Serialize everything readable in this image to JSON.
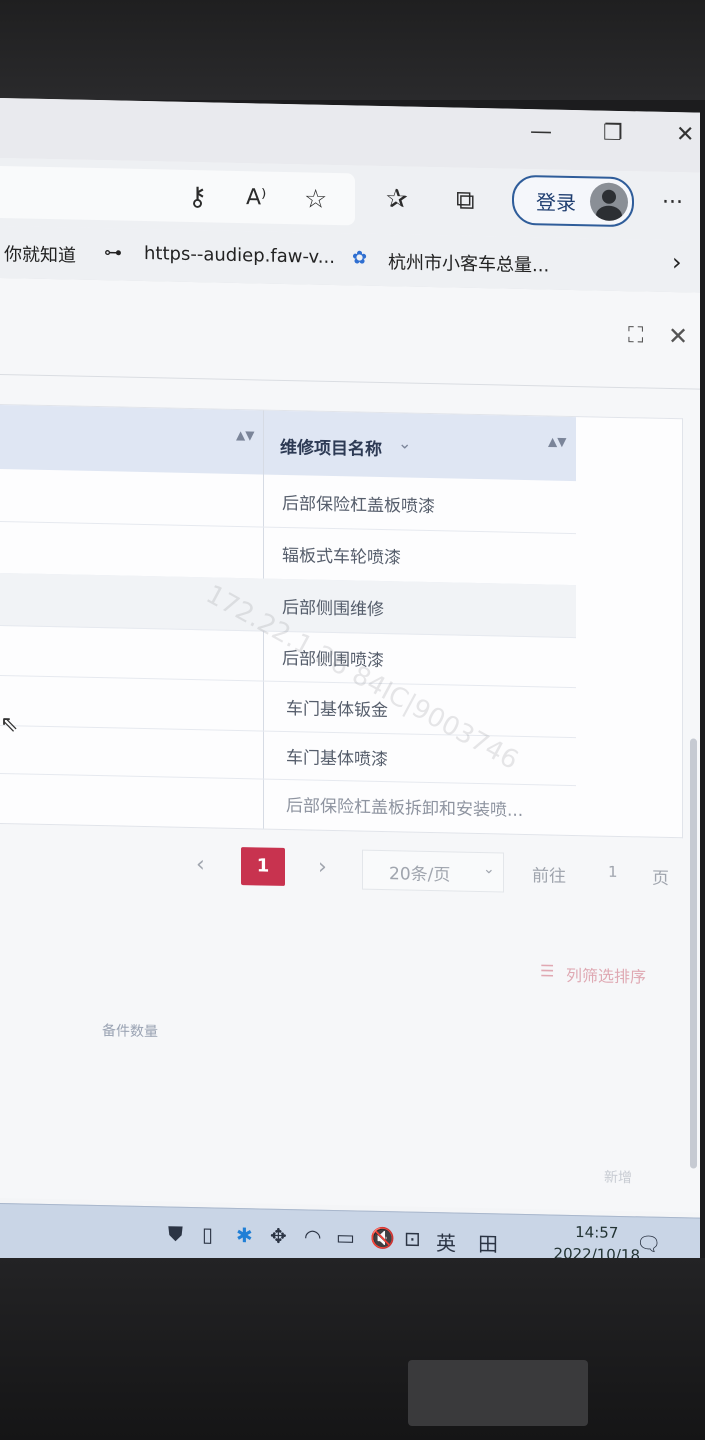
{
  "window": {
    "minimize_icon": "minimize-icon",
    "restore_icon": "restore-icon",
    "close_icon": "close-icon",
    "minimize_glyph": "—",
    "restore_glyph": "❐",
    "close_glyph": "✕"
  },
  "toolbar": {
    "key_glyph": "⚷",
    "read_aloud": "A⁾",
    "favorite_glyph": "☆",
    "favorites_glyph": "✰",
    "collections_glyph": "⧉",
    "login_label": "登录",
    "more_glyph": "···"
  },
  "bookmarks": {
    "items": [
      {
        "label": "你就知道"
      },
      {
        "label": "https--audiep.faw-v..."
      },
      {
        "label": "杭州市小客车总量..."
      }
    ],
    "link_glyph": "⊶",
    "flower_glyph": "✿",
    "more_glyph": "›"
  },
  "dialog": {
    "fullscreen_glyph": "⛶",
    "close_glyph": "✕"
  },
  "table": {
    "column_header": "维修项目名称",
    "header_chevron": "⌄",
    "sort_glyph": "▲▼",
    "rows": [
      "后部保险杠盖板喷漆",
      "辐板式车轮喷漆",
      "后部侧围维修",
      "后部侧围喷漆",
      "车门基体钣金",
      "车门基体喷漆",
      "后部保险杠盖板拆卸和安装喷..."
    ]
  },
  "pagination": {
    "prev": "‹",
    "current_page": "1",
    "next": "›",
    "page_size": "20条/页",
    "goto_label": "前往",
    "goto_value": "1",
    "page_suffix": "页"
  },
  "footer": {
    "column_filter_sort": "列筛选排序",
    "filter_glyph": "☰",
    "spare_parts": "备件数量",
    "bottom_right": "新增"
  },
  "watermark": "172.22.1.26 84IC|9003746",
  "taskbar": {
    "ime": "英",
    "grid_glyph": "田",
    "time": "14:57",
    "date": "2022/10/18",
    "notify_glyph": "🗨"
  }
}
